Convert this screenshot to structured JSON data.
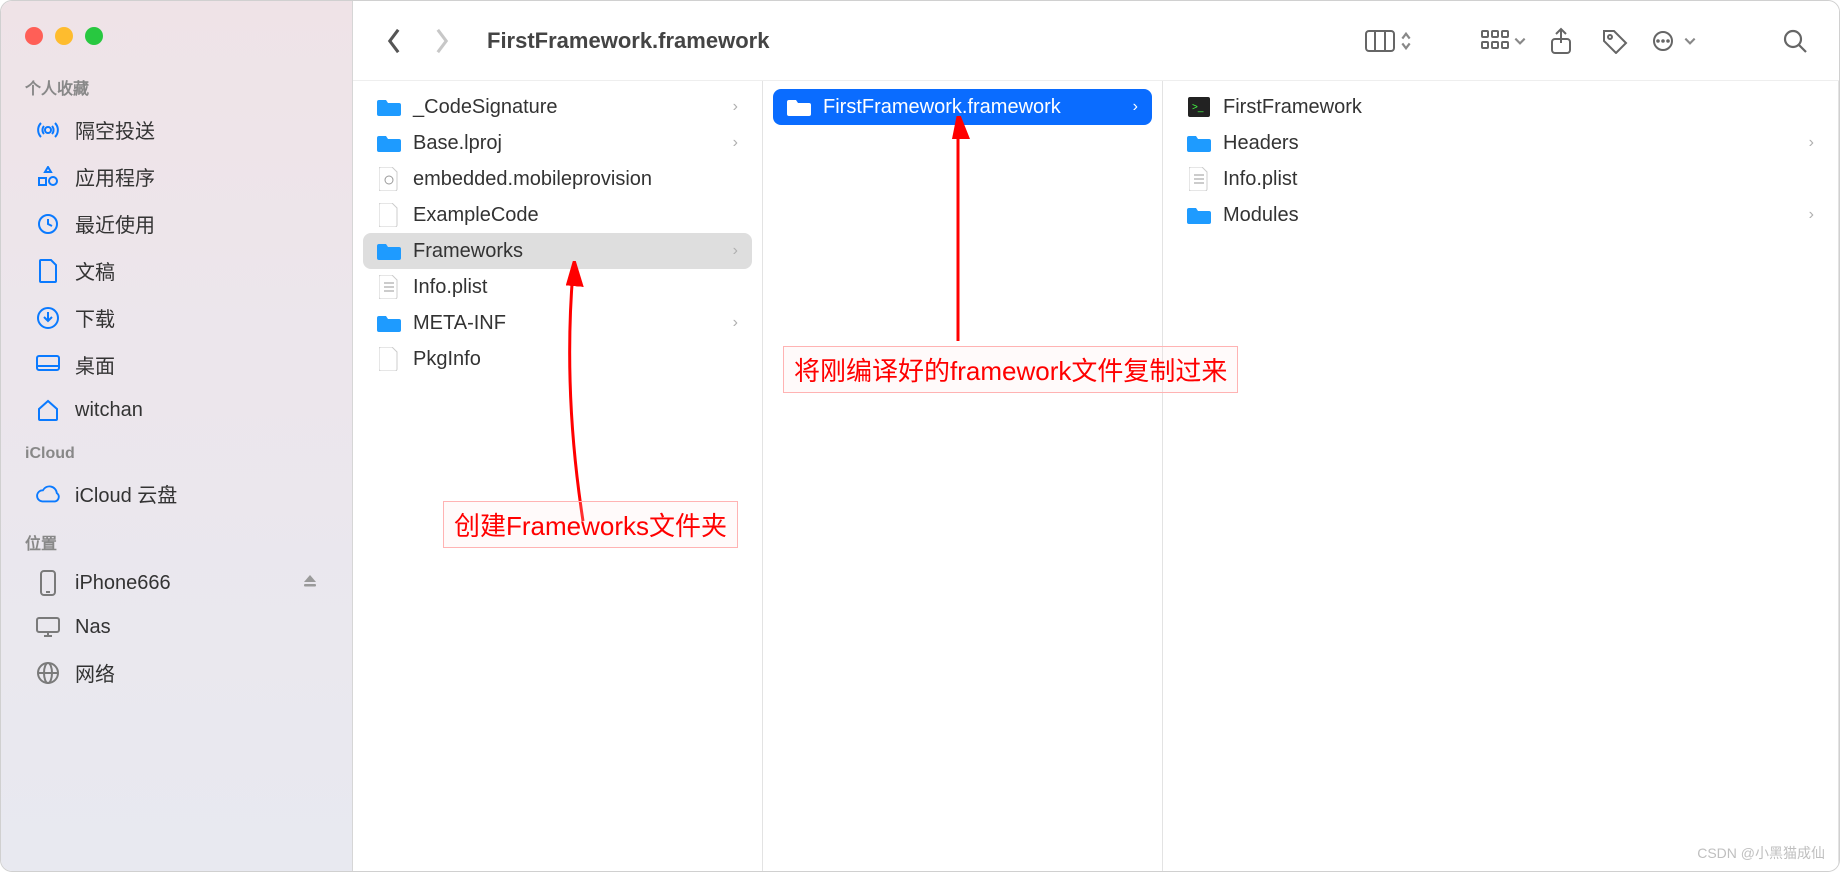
{
  "toolbar": {
    "title": "FirstFramework.framework"
  },
  "sidebar": {
    "sections": [
      {
        "header": "个人收藏",
        "items": [
          {
            "icon": "airdrop",
            "label": "隔空投送"
          },
          {
            "icon": "apps",
            "label": "应用程序"
          },
          {
            "icon": "recent",
            "label": "最近使用"
          },
          {
            "icon": "doc",
            "label": "文稿"
          },
          {
            "icon": "download",
            "label": "下载"
          },
          {
            "icon": "desktop",
            "label": "桌面"
          },
          {
            "icon": "home",
            "label": "witchan"
          }
        ]
      },
      {
        "header": "iCloud",
        "items": [
          {
            "icon": "cloud",
            "label": "iCloud 云盘"
          }
        ]
      },
      {
        "header": "位置",
        "items": [
          {
            "icon": "phone",
            "label": "iPhone666",
            "eject": true,
            "gray": true
          },
          {
            "icon": "display",
            "label": "Nas",
            "gray": true
          },
          {
            "icon": "globe",
            "label": "网络",
            "gray": true
          }
        ]
      }
    ]
  },
  "col1": [
    {
      "icon": "folder",
      "label": "_CodeSignature",
      "chev": true
    },
    {
      "icon": "folder",
      "label": "Base.lproj",
      "chev": true
    },
    {
      "icon": "gear-file",
      "label": "embedded.mobileprovision"
    },
    {
      "icon": "blank-file",
      "label": "ExampleCode"
    },
    {
      "icon": "folder",
      "label": "Frameworks",
      "chev": true,
      "selected": "light"
    },
    {
      "icon": "plist",
      "label": "Info.plist"
    },
    {
      "icon": "folder",
      "label": "META-INF",
      "chev": true
    },
    {
      "icon": "blank-file",
      "label": "PkgInfo"
    }
  ],
  "col2": [
    {
      "icon": "folder",
      "label": "FirstFramework.framework",
      "chev": true,
      "selected": "blue"
    }
  ],
  "col3": [
    {
      "icon": "exec",
      "label": "FirstFramework"
    },
    {
      "icon": "folder",
      "label": "Headers",
      "chev": true
    },
    {
      "icon": "plist",
      "label": "Info.plist"
    },
    {
      "icon": "folder",
      "label": "Modules",
      "chev": true
    }
  ],
  "annotations": {
    "a1": "创建Frameworks文件夹",
    "a2": "将刚编译好的framework文件复制过来"
  },
  "watermark": "CSDN @小黑猫成仙"
}
